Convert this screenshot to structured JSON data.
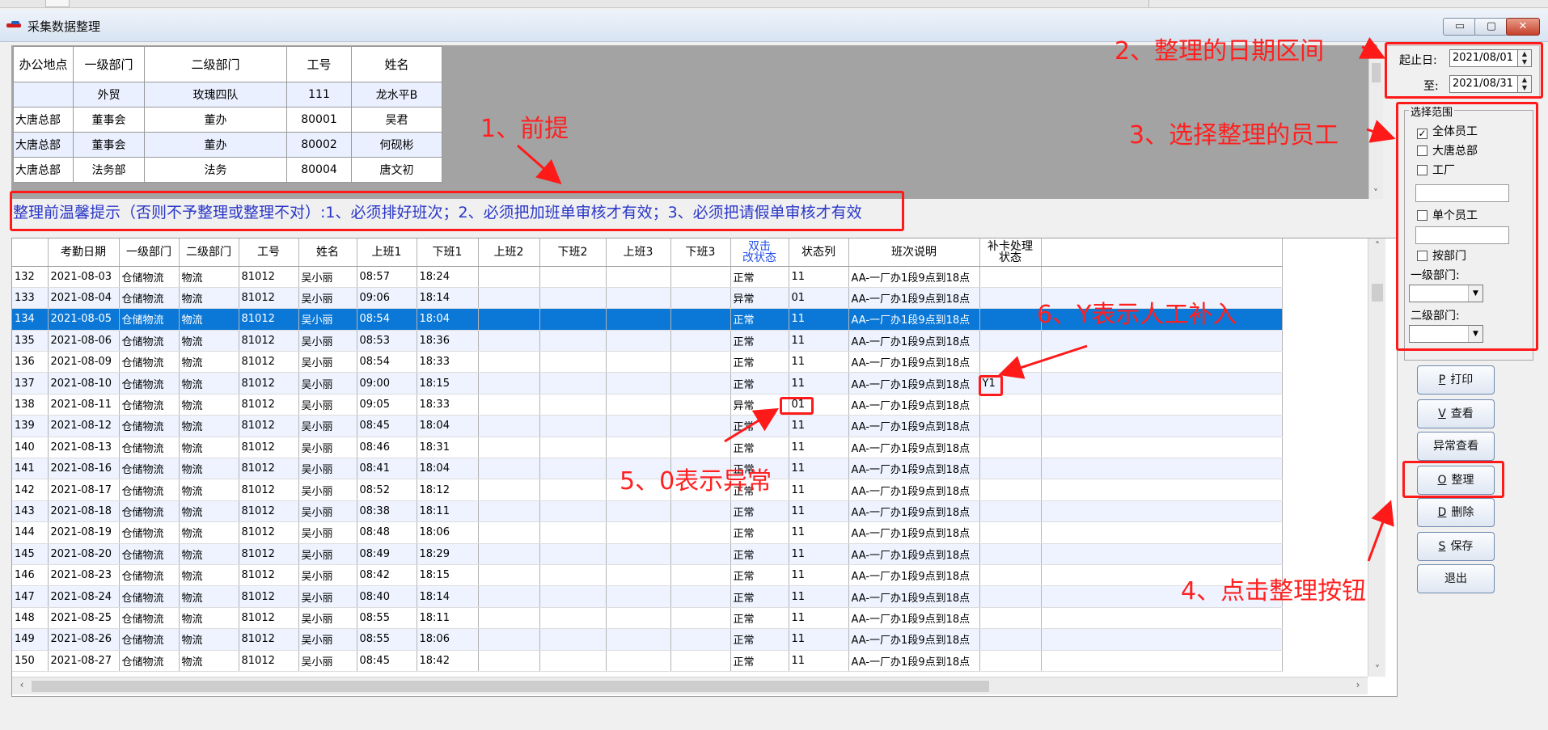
{
  "window": {
    "title": "采集数据整理",
    "min_glyph": "▭",
    "max_glyph": "▢",
    "close_glyph": "✕"
  },
  "top_table": {
    "headers": [
      "办公地点",
      "一级部门",
      "二级部门",
      "工号",
      "姓名"
    ],
    "rows": [
      [
        "",
        "外贸",
        "玫瑰四队",
        "111",
        "龙水平B"
      ],
      [
        "大唐总部",
        "董事会",
        "董办",
        "80001",
        "吴君"
      ],
      [
        "大唐总部",
        "董事会",
        "董办",
        "80002",
        "何砚彬"
      ],
      [
        "大唐总部",
        "法务部",
        "法务",
        "80004",
        "唐文初"
      ]
    ]
  },
  "notice": "整理前温馨提示（否则不予整理或整理不对）:1、必须排好班次；2、必须把加班单审核才有效；3、必须把请假单审核才有效",
  "grid": {
    "headers": [
      "",
      "考勤日期",
      "一级部门",
      "二级部门",
      "工号",
      "姓名",
      "上班1",
      "下班1",
      "上班2",
      "下班2",
      "上班3",
      "下班3",
      "双击\n改状态",
      "状态列",
      "班次说明",
      "补卡处理\n状态",
      ""
    ],
    "rows": [
      [
        "132",
        "2021-08-03",
        "仓储物流",
        "物流",
        "81012",
        "吴小丽",
        "08:57",
        "18:24",
        "",
        "",
        "",
        "",
        "正常",
        "11",
        "AA-一厂办1段9点到18点",
        ""
      ],
      [
        "133",
        "2021-08-04",
        "仓储物流",
        "物流",
        "81012",
        "吴小丽",
        "09:06",
        "18:14",
        "",
        "",
        "",
        "",
        "异常",
        "01",
        "AA-一厂办1段9点到18点",
        ""
      ],
      [
        "134",
        "2021-08-05",
        "仓储物流",
        "物流",
        "81012",
        "吴小丽",
        "08:54",
        "18:04",
        "",
        "",
        "",
        "",
        "正常",
        "11",
        "AA-一厂办1段9点到18点",
        ""
      ],
      [
        "135",
        "2021-08-06",
        "仓储物流",
        "物流",
        "81012",
        "吴小丽",
        "08:53",
        "18:36",
        "",
        "",
        "",
        "",
        "正常",
        "11",
        "AA-一厂办1段9点到18点",
        ""
      ],
      [
        "136",
        "2021-08-09",
        "仓储物流",
        "物流",
        "81012",
        "吴小丽",
        "08:54",
        "18:33",
        "",
        "",
        "",
        "",
        "正常",
        "11",
        "AA-一厂办1段9点到18点",
        ""
      ],
      [
        "137",
        "2021-08-10",
        "仓储物流",
        "物流",
        "81012",
        "吴小丽",
        "09:00",
        "18:15",
        "",
        "",
        "",
        "",
        "正常",
        "11",
        "AA-一厂办1段9点到18点",
        "Y1"
      ],
      [
        "138",
        "2021-08-11",
        "仓储物流",
        "物流",
        "81012",
        "吴小丽",
        "09:05",
        "18:33",
        "",
        "",
        "",
        "",
        "异常",
        "01",
        "AA-一厂办1段9点到18点",
        ""
      ],
      [
        "139",
        "2021-08-12",
        "仓储物流",
        "物流",
        "81012",
        "吴小丽",
        "08:45",
        "18:04",
        "",
        "",
        "",
        "",
        "正常",
        "11",
        "AA-一厂办1段9点到18点",
        ""
      ],
      [
        "140",
        "2021-08-13",
        "仓储物流",
        "物流",
        "81012",
        "吴小丽",
        "08:46",
        "18:31",
        "",
        "",
        "",
        "",
        "正常",
        "11",
        "AA-一厂办1段9点到18点",
        ""
      ],
      [
        "141",
        "2021-08-16",
        "仓储物流",
        "物流",
        "81012",
        "吴小丽",
        "08:41",
        "18:04",
        "",
        "",
        "",
        "",
        "正常",
        "11",
        "AA-一厂办1段9点到18点",
        ""
      ],
      [
        "142",
        "2021-08-17",
        "仓储物流",
        "物流",
        "81012",
        "吴小丽",
        "08:52",
        "18:12",
        "",
        "",
        "",
        "",
        "正常",
        "11",
        "AA-一厂办1段9点到18点",
        ""
      ],
      [
        "143",
        "2021-08-18",
        "仓储物流",
        "物流",
        "81012",
        "吴小丽",
        "08:38",
        "18:11",
        "",
        "",
        "",
        "",
        "正常",
        "11",
        "AA-一厂办1段9点到18点",
        ""
      ],
      [
        "144",
        "2021-08-19",
        "仓储物流",
        "物流",
        "81012",
        "吴小丽",
        "08:48",
        "18:06",
        "",
        "",
        "",
        "",
        "正常",
        "11",
        "AA-一厂办1段9点到18点",
        ""
      ],
      [
        "145",
        "2021-08-20",
        "仓储物流",
        "物流",
        "81012",
        "吴小丽",
        "08:49",
        "18:29",
        "",
        "",
        "",
        "",
        "正常",
        "11",
        "AA-一厂办1段9点到18点",
        ""
      ],
      [
        "146",
        "2021-08-23",
        "仓储物流",
        "物流",
        "81012",
        "吴小丽",
        "08:42",
        "18:15",
        "",
        "",
        "",
        "",
        "正常",
        "11",
        "AA-一厂办1段9点到18点",
        ""
      ],
      [
        "147",
        "2021-08-24",
        "仓储物流",
        "物流",
        "81012",
        "吴小丽",
        "08:40",
        "18:14",
        "",
        "",
        "",
        "",
        "正常",
        "11",
        "AA-一厂办1段9点到18点",
        ""
      ],
      [
        "148",
        "2021-08-25",
        "仓储物流",
        "物流",
        "81012",
        "吴小丽",
        "08:55",
        "18:11",
        "",
        "",
        "",
        "",
        "正常",
        "11",
        "AA-一厂办1段9点到18点",
        ""
      ],
      [
        "149",
        "2021-08-26",
        "仓储物流",
        "物流",
        "81012",
        "吴小丽",
        "08:55",
        "18:06",
        "",
        "",
        "",
        "",
        "正常",
        "11",
        "AA-一厂办1段9点到18点",
        ""
      ],
      [
        "150",
        "2021-08-27",
        "仓储物流",
        "物流",
        "81012",
        "吴小丽",
        "08:45",
        "18:42",
        "",
        "",
        "",
        "",
        "正常",
        "11",
        "AA-一厂办1段9点到18点",
        ""
      ]
    ],
    "selected_row": "134"
  },
  "date_range": {
    "start_label": "起止日:",
    "start_value": "2021/08/01",
    "end_label": "至:",
    "end_value": "2021/08/31"
  },
  "scope": {
    "legend": "选择范围",
    "all_staff": "全体员工",
    "all_staff_checked": "✓",
    "hq": "大唐总部",
    "factory": "工厂",
    "single_staff": "单个员工",
    "by_dept": "按部门",
    "dept1_label": "一级部门:",
    "dept2_label": "二级部门:"
  },
  "buttons": {
    "print_key": "P",
    "print": "打印",
    "view_key": "V",
    "view": "查看",
    "abnormal_view": "异常查看",
    "organize_key": "O",
    "organize": "整理",
    "delete_key": "D",
    "delete": "删除",
    "save_key": "S",
    "save": "保存",
    "exit": "退出"
  },
  "annotations": {
    "a1": "1、前提",
    "a2": "2、整理的日期区间",
    "a3": "3、选择整理的员工",
    "a4": "4、点击整理按钮",
    "a5": "5、0表示异常",
    "a6": "6、Y表示人工补入"
  },
  "colors": {
    "selection": "#0b78d7",
    "annotation": "#ff1a1a",
    "notice_text": "#2a36c8",
    "header_blue": "#2550e6"
  }
}
